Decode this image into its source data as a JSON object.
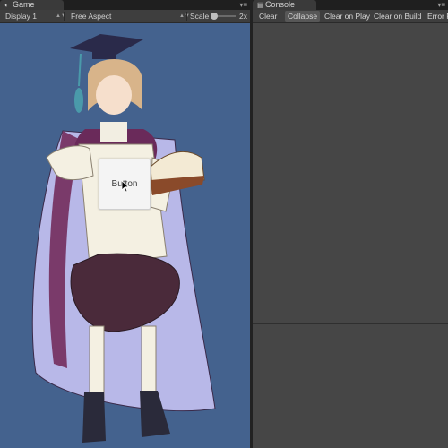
{
  "game": {
    "tab_label": "Game",
    "display": "Display 1",
    "aspect": "Free Aspect",
    "scale_label": "Scale",
    "scale_value": "2x",
    "viewport_bg": "#44628e",
    "ui_button_label": "Button"
  },
  "console": {
    "tab_label": "Console",
    "buttons": [
      "Clear",
      "Collapse",
      "Clear on Play",
      "Clear on Build",
      "Error P"
    ]
  },
  "icons": {
    "game_tab": "game-controller-icon",
    "console_tab": "console-icon",
    "menu": "menu-icon",
    "cursor": "mouse-pointer-icon"
  }
}
